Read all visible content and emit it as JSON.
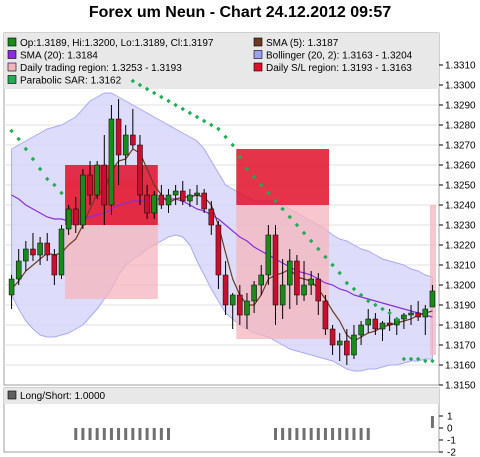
{
  "title": "Forex um Neun - Chart 24.12.2012 09:57",
  "legend": [
    {
      "label": "Op:1.3189, Hi:1.3200, Lo:1.3189, Cl:1.3197",
      "color": "#1a8a1a"
    },
    {
      "label": "SMA (5): 1.3187",
      "color": "#6b3a1f"
    },
    {
      "label": "SMA (20): 1.3184",
      "color": "#8a2be2"
    },
    {
      "label": "Bollinger (20, 2): 1.3163 - 1.3204",
      "color": "#9ea0f0"
    },
    {
      "label": "Daily trading region: 1.3253 - 1.3193",
      "color": "#f4b4bc"
    },
    {
      "label": "Daily S/L region: 1.3193 - 1.3163",
      "color": "#e0102a"
    },
    {
      "label": "Parabolic SAR: 1.3162",
      "color": "#22aa55"
    }
  ],
  "lower_legend": {
    "label": "Long/Short: 1.0000",
    "color": "#606060"
  },
  "chart_data": [
    {
      "type": "candlestick",
      "title": "Forex um Neun - Chart 24.12.2012 09:57",
      "ylim": [
        1.315,
        1.3312
      ],
      "yticks": [
        "1.3310",
        "1.3300",
        "1.3290",
        "1.3280",
        "1.3270",
        "1.3260",
        "1.3250",
        "1.3240",
        "1.3230",
        "1.3220",
        "1.3210",
        "1.3200",
        "1.3190",
        "1.3180",
        "1.3170",
        "1.3160",
        "1.3150"
      ],
      "candles": [
        [
          1.3195,
          1.3205,
          1.3188,
          1.3203
        ],
        [
          1.3203,
          1.3218,
          1.32,
          1.3212
        ],
        [
          1.3212,
          1.3222,
          1.3207,
          1.3218
        ],
        [
          1.3218,
          1.3226,
          1.3212,
          1.3215
        ],
        [
          1.3215,
          1.3224,
          1.321,
          1.3221
        ],
        [
          1.3221,
          1.3226,
          1.3212,
          1.3215
        ],
        [
          1.3215,
          1.3218,
          1.32,
          1.3205
        ],
        [
          1.3205,
          1.323,
          1.3203,
          1.3228
        ],
        [
          1.3228,
          1.324,
          1.3225,
          1.3238
        ],
        [
          1.3238,
          1.3244,
          1.3226,
          1.323
        ],
        [
          1.323,
          1.3258,
          1.3228,
          1.3255
        ],
        [
          1.3255,
          1.3262,
          1.324,
          1.3245
        ],
        [
          1.3245,
          1.3262,
          1.3243,
          1.326
        ],
        [
          1.326,
          1.3275,
          1.323,
          1.324
        ],
        [
          1.324,
          1.329,
          1.3235,
          1.3283
        ],
        [
          1.3283,
          1.3293,
          1.325,
          1.3265
        ],
        [
          1.3265,
          1.328,
          1.326,
          1.3275
        ],
        [
          1.3275,
          1.3288,
          1.3268,
          1.327
        ],
        [
          1.327,
          1.3275,
          1.324,
          1.3245
        ],
        [
          1.3245,
          1.325,
          1.3233,
          1.3236
        ],
        [
          1.3236,
          1.3247,
          1.3233,
          1.3245
        ],
        [
          1.3245,
          1.325,
          1.3238,
          1.324
        ],
        [
          1.324,
          1.3248,
          1.3236,
          1.3245
        ],
        [
          1.3245,
          1.325,
          1.324,
          1.3247
        ],
        [
          1.3247,
          1.3252,
          1.324,
          1.3242
        ],
        [
          1.3242,
          1.3248,
          1.3239,
          1.3245
        ],
        [
          1.3245,
          1.325,
          1.324,
          1.3246
        ],
        [
          1.3246,
          1.3248,
          1.3236,
          1.3238
        ],
        [
          1.3238,
          1.3242,
          1.3225,
          1.323
        ],
        [
          1.323,
          1.3232,
          1.3198,
          1.3205
        ],
        [
          1.3205,
          1.3212,
          1.3185,
          1.319
        ],
        [
          1.319,
          1.3196,
          1.3178,
          1.3195
        ],
        [
          1.3195,
          1.32,
          1.318,
          1.3185
        ],
        [
          1.3185,
          1.3196,
          1.3178,
          1.3192
        ],
        [
          1.3192,
          1.3202,
          1.3186,
          1.32
        ],
        [
          1.32,
          1.321,
          1.3195,
          1.3205
        ],
        [
          1.3205,
          1.323,
          1.32,
          1.3225
        ],
        [
          1.3225,
          1.323,
          1.318,
          1.319
        ],
        [
          1.319,
          1.3213,
          1.3183,
          1.32
        ],
        [
          1.32,
          1.3218,
          1.3188,
          1.3212
        ],
        [
          1.3212,
          1.3215,
          1.319,
          1.3195
        ],
        [
          1.3195,
          1.3212,
          1.3192,
          1.32
        ],
        [
          1.32,
          1.3207,
          1.3195,
          1.3203
        ],
        [
          1.3203,
          1.3206,
          1.3185,
          1.3192
        ],
        [
          1.3192,
          1.3195,
          1.3175,
          1.3178
        ],
        [
          1.3178,
          1.318,
          1.3165,
          1.317
        ],
        [
          1.317,
          1.3176,
          1.3162,
          1.3172
        ],
        [
          1.3172,
          1.3178,
          1.316,
          1.3165
        ],
        [
          1.3165,
          1.318,
          1.3163,
          1.3175
        ],
        [
          1.3175,
          1.3182,
          1.317,
          1.318
        ],
        [
          1.318,
          1.3188,
          1.3176,
          1.3183
        ],
        [
          1.3183,
          1.3186,
          1.3175,
          1.3178
        ],
        [
          1.3178,
          1.3182,
          1.3172,
          1.3181
        ],
        [
          1.3181,
          1.3188,
          1.3177,
          1.318
        ],
        [
          1.318,
          1.3184,
          1.3175,
          1.3183
        ],
        [
          1.3183,
          1.3186,
          1.3178,
          1.3185
        ],
        [
          1.3185,
          1.319,
          1.318,
          1.3186
        ],
        [
          1.3186,
          1.3192,
          1.3182,
          1.3184
        ],
        [
          1.3184,
          1.319,
          1.3175,
          1.3188
        ],
        [
          1.3189,
          1.32,
          1.3189,
          1.3197
        ]
      ],
      "sma5": [
        1.3198,
        1.3202,
        1.3207,
        1.321,
        1.3213,
        1.3216,
        1.3215,
        1.3216,
        1.322,
        1.3223,
        1.323,
        1.3238,
        1.3246,
        1.3247,
        1.3257,
        1.3262,
        1.3263,
        1.3268,
        1.3266,
        1.3258,
        1.325,
        1.3245,
        1.3241,
        1.3243,
        1.3244,
        1.3244,
        1.3245,
        1.3244,
        1.324,
        1.323,
        1.3216,
        1.3203,
        1.3195,
        1.319,
        1.319,
        1.3195,
        1.3203,
        1.3205,
        1.3206,
        1.3208,
        1.3204,
        1.3203,
        1.3202,
        1.3198,
        1.3193,
        1.3187,
        1.3182,
        1.3175,
        1.3172,
        1.3174,
        1.3176,
        1.3177,
        1.3179,
        1.318,
        1.3181,
        1.3182,
        1.3183,
        1.3185,
        1.3186,
        1.3187
      ],
      "sma20": [
        1.3245,
        1.3243,
        1.324,
        1.3238,
        1.3236,
        1.3234,
        1.3233,
        1.3233,
        1.3232,
        1.3232,
        1.3233,
        1.3234,
        1.3235,
        1.3236,
        1.3238,
        1.324,
        1.3241,
        1.3242,
        1.3242,
        1.3242,
        1.3243,
        1.3243,
        1.3243,
        1.3243,
        1.3242,
        1.324,
        1.3238,
        1.3237,
        1.3235,
        1.3233,
        1.323,
        1.3227,
        1.3224,
        1.3222,
        1.3219,
        1.3217,
        1.3215,
        1.3213,
        1.3211,
        1.3209,
        1.3207,
        1.3206,
        1.3205,
        1.3203,
        1.3201,
        1.32,
        1.3198,
        1.3197,
        1.3195,
        1.3194,
        1.3193,
        1.3192,
        1.3191,
        1.319,
        1.3189,
        1.3188,
        1.3187,
        1.3186,
        1.3185,
        1.3184
      ],
      "bollinger_upper": [
        1.3268,
        1.327,
        1.3272,
        1.3274,
        1.3276,
        1.3278,
        1.3279,
        1.328,
        1.3282,
        1.3284,
        1.3288,
        1.3292,
        1.3294,
        1.3296,
        1.3296,
        1.3294,
        1.3292,
        1.329,
        1.3288,
        1.3286,
        1.3284,
        1.3282,
        1.328,
        1.3278,
        1.3276,
        1.3274,
        1.3272,
        1.3268,
        1.3262,
        1.3256,
        1.325,
        1.3248,
        1.3246,
        1.3244,
        1.3242,
        1.3242,
        1.3242,
        1.3242,
        1.324,
        1.3238,
        1.3236,
        1.3234,
        1.3232,
        1.323,
        1.3228,
        1.3225,
        1.3223,
        1.3222,
        1.322,
        1.3218,
        1.3217,
        1.3215,
        1.3213,
        1.3212,
        1.3211,
        1.321,
        1.3208,
        1.3207,
        1.3205,
        1.3204
      ],
      "bollinger_lower": [
        1.3195,
        1.3188,
        1.3182,
        1.3178,
        1.3175,
        1.3174,
        1.3174,
        1.3175,
        1.3176,
        1.3178,
        1.318,
        1.3184,
        1.3188,
        1.3193,
        1.3198,
        1.3205,
        1.321,
        1.3213,
        1.3215,
        1.3218,
        1.322,
        1.3222,
        1.3224,
        1.3225,
        1.3224,
        1.322,
        1.3212,
        1.3205,
        1.3198,
        1.3192,
        1.3186,
        1.3183,
        1.318,
        1.3178,
        1.3176,
        1.3175,
        1.3174,
        1.3172,
        1.317,
        1.3168,
        1.3167,
        1.3166,
        1.3165,
        1.3164,
        1.3163,
        1.3162,
        1.316,
        1.3158,
        1.3157,
        1.3157,
        1.3158,
        1.3158,
        1.3159,
        1.316,
        1.316,
        1.3161,
        1.3162,
        1.3162,
        1.3163,
        1.3163
      ],
      "sar": [
        1.3277,
        1.3273,
        1.3268,
        1.3263,
        1.3258,
        1.3253,
        1.325,
        1.3246,
        null,
        null,
        null,
        null,
        null,
        null,
        null,
        null,
        null,
        1.3302,
        1.33,
        1.3298,
        1.3296,
        1.3294,
        1.3292,
        1.329,
        1.3288,
        1.3286,
        1.3284,
        1.3282,
        1.328,
        1.3278,
        1.3274,
        1.327,
        1.3264,
        1.3258,
        1.3254,
        1.325,
        1.3246,
        1.3242,
        1.3238,
        1.3234,
        1.323,
        1.3226,
        1.3222,
        1.3218,
        1.3214,
        1.321,
        1.3206,
        1.3201,
        1.3198,
        1.3195,
        1.3192,
        1.319,
        1.3188,
        1.3186,
        1.3183,
        1.3163,
        1.3163,
        1.3163,
        1.3162,
        1.3162
      ],
      "sar_segments": [
        {
          "from": 0,
          "to": 7
        },
        {
          "from": 17,
          "to": 54
        },
        {
          "from": 55,
          "to": 59
        }
      ],
      "regions": [
        {
          "name": "Daily trading region",
          "from": 8,
          "to": 20,
          "range": [
            1.3253,
            1.3193
          ],
          "color": "#f4b4bc"
        },
        {
          "name": "Daily S/L region",
          "from": 8,
          "to": 20,
          "range": [
            1.326,
            1.323
          ],
          "color": "#e0102a"
        },
        {
          "name": "Daily trading region",
          "from": 32,
          "to": 44,
          "range": [
            1.324,
            1.3173
          ],
          "color": "#f4b4bc"
        },
        {
          "name": "Daily S/L region",
          "from": 32,
          "to": 44,
          "range": [
            1.3268,
            1.324
          ],
          "color": "#e0102a"
        }
      ]
    },
    {
      "type": "bar",
      "title": "Long/Short: 1.0000",
      "ylim": [
        -2,
        2
      ],
      "yticks": [
        "1",
        "0",
        "-1",
        "-2"
      ],
      "long_short": [
        0,
        0,
        0,
        0,
        0,
        0,
        0,
        0,
        0,
        -1,
        -1,
        -1,
        -1,
        -1,
        -1,
        -1,
        -1,
        -1,
        -1,
        -1,
        -1,
        -1,
        -1,
        0,
        0,
        0,
        0,
        0,
        0,
        0,
        0,
        0,
        0,
        0,
        0,
        0,
        0,
        -1,
        -1,
        -1,
        -1,
        -1,
        -1,
        -1,
        -1,
        -1,
        -1,
        -1,
        -1,
        -1,
        -1,
        0,
        0,
        0,
        0,
        0,
        0,
        0,
        0,
        1
      ]
    }
  ]
}
